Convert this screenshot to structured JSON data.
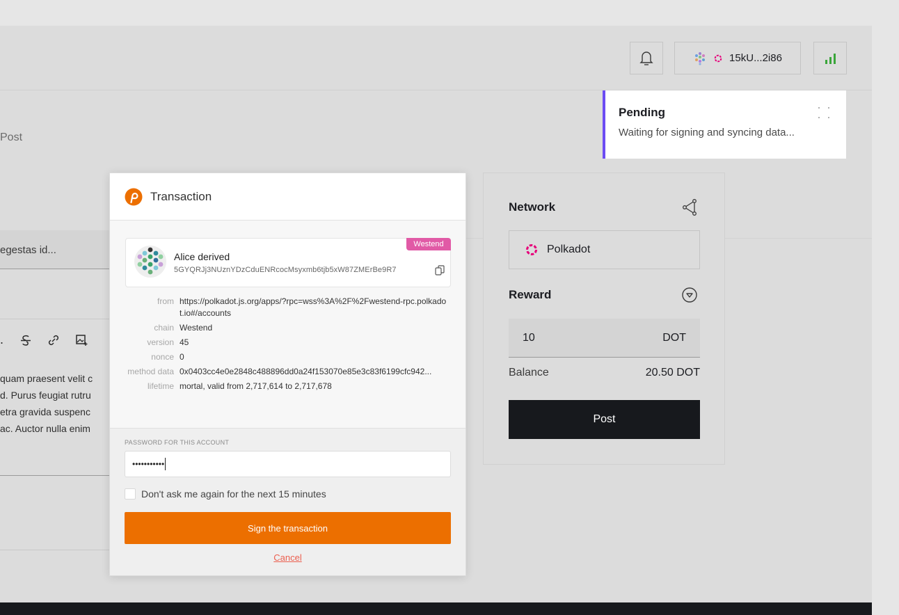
{
  "header": {
    "account_address": "15kU...2i86"
  },
  "page": {
    "heading_fragment": "Post"
  },
  "editor": {
    "title_value": "egestas id...",
    "body_lines": [
      "quam praesent velit c",
      "d. Purus feugiat rutru",
      "etra gravida suspenc",
      "ac. Auctor nulla enim"
    ]
  },
  "sidebar": {
    "network_label": "Network",
    "network_value": "Polkadot",
    "reward_label": "Reward",
    "reward_amount": "10",
    "reward_unit": "DOT",
    "balance_label": "Balance",
    "balance_value": "20.50 DOT",
    "post_label": "Post"
  },
  "notification": {
    "title": "Pending",
    "text": "Waiting for signing and syncing data..."
  },
  "popup": {
    "title": "Transaction",
    "account": {
      "name": "Alice derived",
      "address": "5GYQRJj3NUznYDzCduENRcocMsyxmb6tjb5xW87ZMErBe9R7",
      "network_badge": "Westend"
    },
    "details": [
      {
        "label": "from",
        "value": "https://polkadot.js.org/apps/?rpc=wss%3A%2F%2Fwestend-rpc.polkadot.io#/accounts"
      },
      {
        "label": "chain",
        "value": "Westend"
      },
      {
        "label": "version",
        "value": "45"
      },
      {
        "label": "nonce",
        "value": "0"
      },
      {
        "label": "method data",
        "value": "0x0403cc4e0e2848c488896dd0a24f153070e85e3c83f6199cfc942..."
      },
      {
        "label": "lifetime",
        "value": "mortal, valid from 2,717,614 to 2,717,678"
      }
    ],
    "password_label": "PASSWORD FOR THIS ACCOUNT",
    "password_mask": "•••••••••••",
    "remember_label": "Don't ask me again for the next 15 minutes",
    "sign_label": "Sign the transaction",
    "cancel_label": "Cancel"
  },
  "colors": {
    "accent_orange": "#ec6f00",
    "pending_border": "#6c4cf3",
    "network_badge": "#e15aa6",
    "polkadot_pink": "#e6007a",
    "signal_green": "#3aa53a"
  }
}
